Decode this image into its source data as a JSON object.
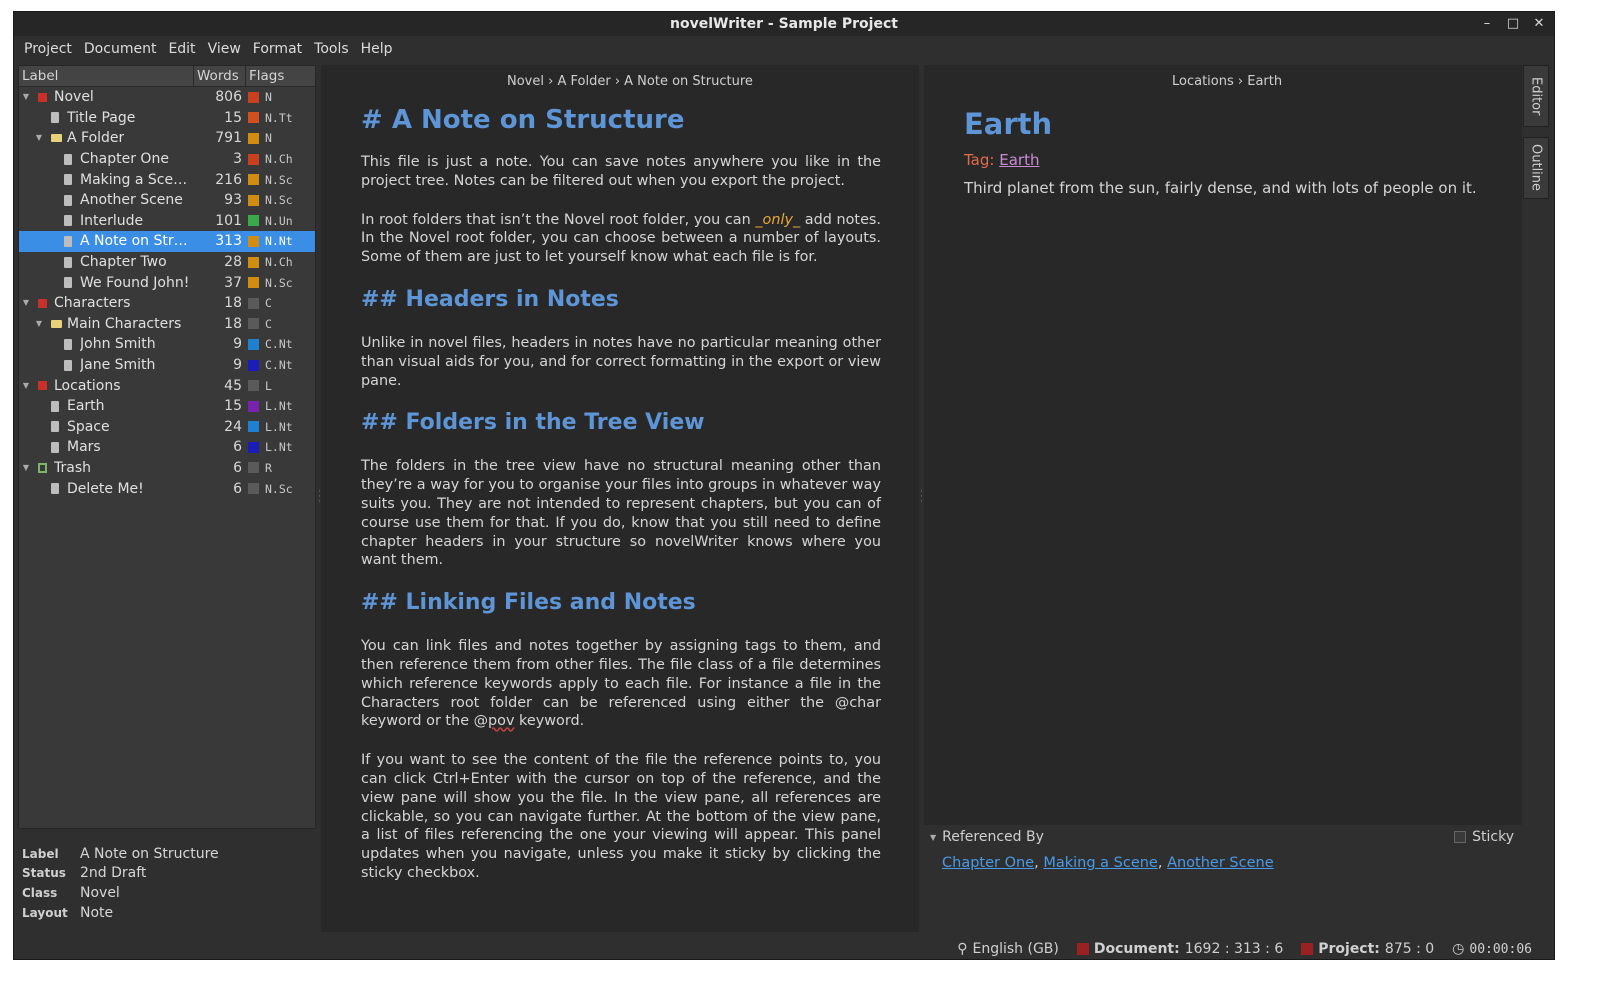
{
  "window": {
    "title": "novelWriter - Sample Project",
    "controls": {
      "minimize": "–",
      "maximize": "□",
      "close": "✕"
    }
  },
  "menu": [
    "Project",
    "Document",
    "Edit",
    "View",
    "Format",
    "Tools",
    "Help"
  ],
  "tree": {
    "headers": {
      "label": "Label",
      "words": "Words",
      "flags": "Flags"
    },
    "rows": [
      {
        "label": "Novel",
        "words": "806",
        "flag": "N",
        "color": "#c8401f",
        "icon": "root",
        "depth": 0,
        "expanded": true
      },
      {
        "label": "Title Page",
        "words": "15",
        "flag": "N.Tt",
        "color": "#d2501e",
        "icon": "file",
        "depth": 1
      },
      {
        "label": "A Folder",
        "words": "791",
        "flag": "N",
        "color": "#d18c12",
        "icon": "folder",
        "depth": 1,
        "expanded": true
      },
      {
        "label": "Chapter One",
        "words": "3",
        "flag": "N.Ch",
        "color": "#c8401f",
        "icon": "file",
        "depth": 2
      },
      {
        "label": "Making a Scene",
        "words": "216",
        "flag": "N.Sc",
        "color": "#d18c12",
        "icon": "file",
        "depth": 2
      },
      {
        "label": "Another Scene",
        "words": "93",
        "flag": "N.Sc",
        "color": "#d18c12",
        "icon": "file",
        "depth": 2
      },
      {
        "label": "Interlude",
        "words": "101",
        "flag": "N.Un",
        "color": "#3aa94a",
        "icon": "file",
        "depth": 2
      },
      {
        "label": "A Note on Struc...",
        "words": "313",
        "flag": "N.Nt",
        "color": "#d18c12",
        "icon": "file",
        "depth": 2,
        "selected": true
      },
      {
        "label": "Chapter Two",
        "words": "28",
        "flag": "N.Ch",
        "color": "#d18c12",
        "icon": "file",
        "depth": 2
      },
      {
        "label": "We Found John!",
        "words": "37",
        "flag": "N.Sc",
        "color": "#d18c12",
        "icon": "file",
        "depth": 2
      },
      {
        "label": "Characters",
        "words": "18",
        "flag": "C",
        "color": "#5a5a5a",
        "icon": "root",
        "depth": 0,
        "expanded": true
      },
      {
        "label": "Main Characters",
        "words": "18",
        "flag": "C",
        "color": "#5a5a5a",
        "icon": "folder",
        "depth": 1,
        "expanded": true
      },
      {
        "label": "John Smith",
        "words": "9",
        "flag": "C.Nt",
        "color": "#1f7fd1",
        "icon": "file",
        "depth": 2
      },
      {
        "label": "Jane Smith",
        "words": "9",
        "flag": "C.Nt",
        "color": "#1c1cb8",
        "icon": "file",
        "depth": 2
      },
      {
        "label": "Locations",
        "words": "45",
        "flag": "L",
        "color": "#5a5a5a",
        "icon": "root",
        "depth": 0,
        "expanded": true
      },
      {
        "label": "Earth",
        "words": "15",
        "flag": "L.Nt",
        "color": "#7a22b0",
        "icon": "file",
        "depth": 1
      },
      {
        "label": "Space",
        "words": "24",
        "flag": "L.Nt",
        "color": "#1f7fd1",
        "icon": "file",
        "depth": 1
      },
      {
        "label": "Mars",
        "words": "6",
        "flag": "L.Nt",
        "color": "#1c1cb8",
        "icon": "file",
        "depth": 1
      },
      {
        "label": "Trash",
        "words": "6",
        "flag": "R",
        "color": "#5a5a5a",
        "icon": "trash",
        "depth": 0,
        "expanded": true
      },
      {
        "label": "Delete Me!",
        "words": "6",
        "flag": "N.Sc",
        "color": "#5a5a5a",
        "icon": "file",
        "depth": 1
      }
    ]
  },
  "details": [
    {
      "label": "Label",
      "value": "A Note on Structure"
    },
    {
      "label": "Status",
      "value": "2nd Draft"
    },
    {
      "label": "Class",
      "value": "Novel"
    },
    {
      "label": "Layout",
      "value": "Note"
    }
  ],
  "editor": {
    "breadcrumb": [
      "Novel",
      "A Folder",
      "A Note on Structure"
    ],
    "separator": "›",
    "title": "# A Note on Structure",
    "p1": "This file is just a note. You can save notes anywhere you like in the project tree. Notes can be filtered out when you export the project.",
    "p2_a": "In root folders that isn’t the Novel root folder, you can ",
    "p2_em": "_only_",
    "p2_b": " add notes. In the Novel root folder, you can choose between a number of layouts. Some of them are just to let yourself know what each file is for.",
    "h2_1": "## Headers in Notes",
    "p3": "Unlike in novel files, headers in notes have no particular meaning other than visual aids for you, and for correct formatting in the export or view pane.",
    "h2_2": "## Folders in the Tree View",
    "p4": "The folders in the tree view have no structural meaning other than they’re a way for you to organise your files into groups in whatever way suits you. They are not intended to represent chapters, but you can of course use them for that. If you do, know that you still need to define chapter headers in your structure so novelWriter knows where you want them.",
    "h2_3": "## Linking Files and Notes",
    "p5_a": "You can link files and notes together by assigning tags to them, and then reference them from other files. The file class of a file determines which reference keywords apply to each file. For instance a file in the Characters root folder can be referenced using either the @char keyword or the @",
    "p5_spell": "pov",
    "p5_b": " keyword.",
    "p6": "If you want to see the content of the file the reference points to, you can click Ctrl+Enter with the cursor on top of the reference, and the view pane will show you the file. In the view pane, all references are clickable, so you can navigate further. At the bottom of the view pane, a list of files referencing the one your viewing will appear. This panel updates when you navigate, unless you make it sticky by clicking the sticky checkbox."
  },
  "viewer": {
    "breadcrumb": [
      "Locations",
      "Earth"
    ],
    "separator": "›",
    "title": "Earth",
    "tag_label": "Tag:",
    "tag_value": "Earth",
    "text": "Third planet from the sun, fairly dense, and with lots of people on it."
  },
  "side_tabs": [
    "Editor",
    "Outline"
  ],
  "referenced_by": {
    "title": "Referenced By",
    "sticky_label": "Sticky",
    "links": [
      "Chapter One",
      "Making a Scene",
      "Another Scene"
    ]
  },
  "status": {
    "language": "English (GB)",
    "document_label": "Document:",
    "document_value": "1692 : 313 : 6",
    "project_label": "Project:",
    "project_value": "875 : 0",
    "timer": "00:00:06"
  }
}
